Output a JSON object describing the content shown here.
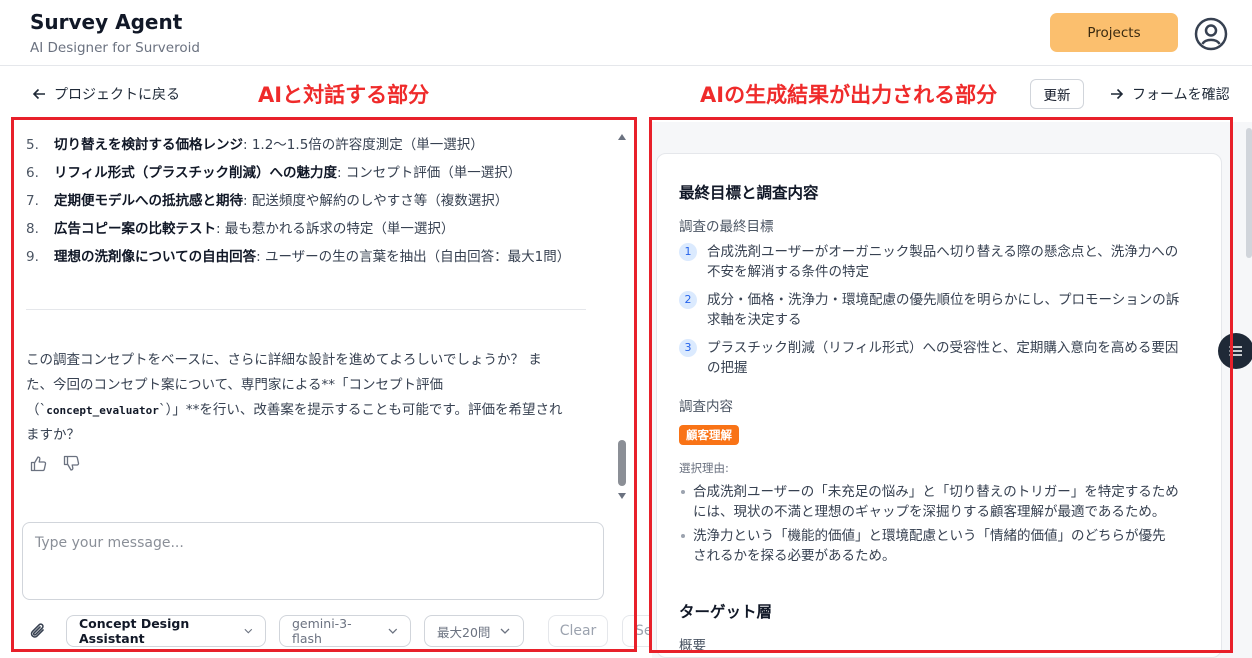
{
  "header": {
    "title": "Survey Agent",
    "subtitle": "AI Designer for Surveroid",
    "projects_button": "Projects",
    "user_icon": "user-circle-icon"
  },
  "subheader": {
    "back_link": "プロジェクトに戻る",
    "left_annotation": "AIと対話する部分",
    "right_annotation": "AIの生成結果が出力される部分",
    "refresh_button": "更新",
    "confirm_link": "フォームを確認"
  },
  "chat": {
    "items": [
      {
        "num": "5.",
        "bold": "切り替えを検討する価格レンジ",
        "rest": ": 1.2〜1.5倍の許容度測定（単一選択）"
      },
      {
        "num": "6.",
        "bold": "リフィル形式（プラスチック削減）への魅力度",
        "rest": ": コンセプト評価（単一選択）"
      },
      {
        "num": "7.",
        "bold": "定期便モデルへの抵抗感と期待",
        "rest": ": 配送頻度や解約のしやすさ等（複数選択）"
      },
      {
        "num": "8.",
        "bold": "広告コピー案の比較テスト",
        "rest": ": 最も惹かれる訴求の特定（単一選択）"
      },
      {
        "num": "9.",
        "bold": "理想の洗剤像についての自由回答",
        "rest": ": ユーザーの生の言葉を抽出（自由回答：最大1問）"
      }
    ],
    "message_line1": "この調査コンセプトをベースに、さらに詳細な設計を進めてよろしいでしょうか？ ま",
    "message_line2": "た、今回のコンセプト案について、専門家による**「コンセプト評価",
    "message_line3a": "（`",
    "message_code": "concept_evaluator",
    "message_line3b": "`）」**を行い、改善案を提示することも可能です。評価を希望され",
    "message_line4": "ますか？",
    "input_placeholder": "Type your message...",
    "agent_select": "Concept Design Assistant",
    "model_select": "gemini-3-flash",
    "max_select": "最大20問",
    "clear_button": "Clear",
    "send_button_partial": "Se"
  },
  "result": {
    "section1_title": "最終目標と調査内容",
    "goal_label": "調査の最終目標",
    "goals": [
      {
        "num": "1",
        "line1": "合成洗剤ユーザーがオーガニック製品へ切り替える際の懸念点と、洗浄力への",
        "line2": "不安を解消する条件の特定"
      },
      {
        "num": "2",
        "line1": "成分・価格・洗浄力・環境配慮の優先順位を明らかにし、プロモーションの訴",
        "line2": "求軸を決定する"
      },
      {
        "num": "3",
        "line1": "プラスチック削減（リフィル形式）への受容性と、定期購入意向を高める要因",
        "line2": "の把握"
      }
    ],
    "content_label": "調査内容",
    "tag": "顧客理解",
    "reason_label": "選択理由:",
    "reasons": [
      {
        "line1": "合成洗剤ユーザーの「未充足の悩み」と「切り替えのトリガー」を特定するため",
        "line2": "には、現状の不満と理想のギャップを深掘りする顧客理解が最適であるため。"
      },
      {
        "line1": "洗浄力という「機能的価値」と環境配慮という「情緒的価値」のどちらが優先",
        "line2": "されるかを探る必要があるため。"
      }
    ],
    "section2_title": "ターゲット層",
    "overview_label": "概要"
  },
  "colors": {
    "annotation_red": "#e8202a",
    "projects_button": "#fbbf6e",
    "tag_orange": "#f97316",
    "goal_badge": "#dbeafe"
  }
}
